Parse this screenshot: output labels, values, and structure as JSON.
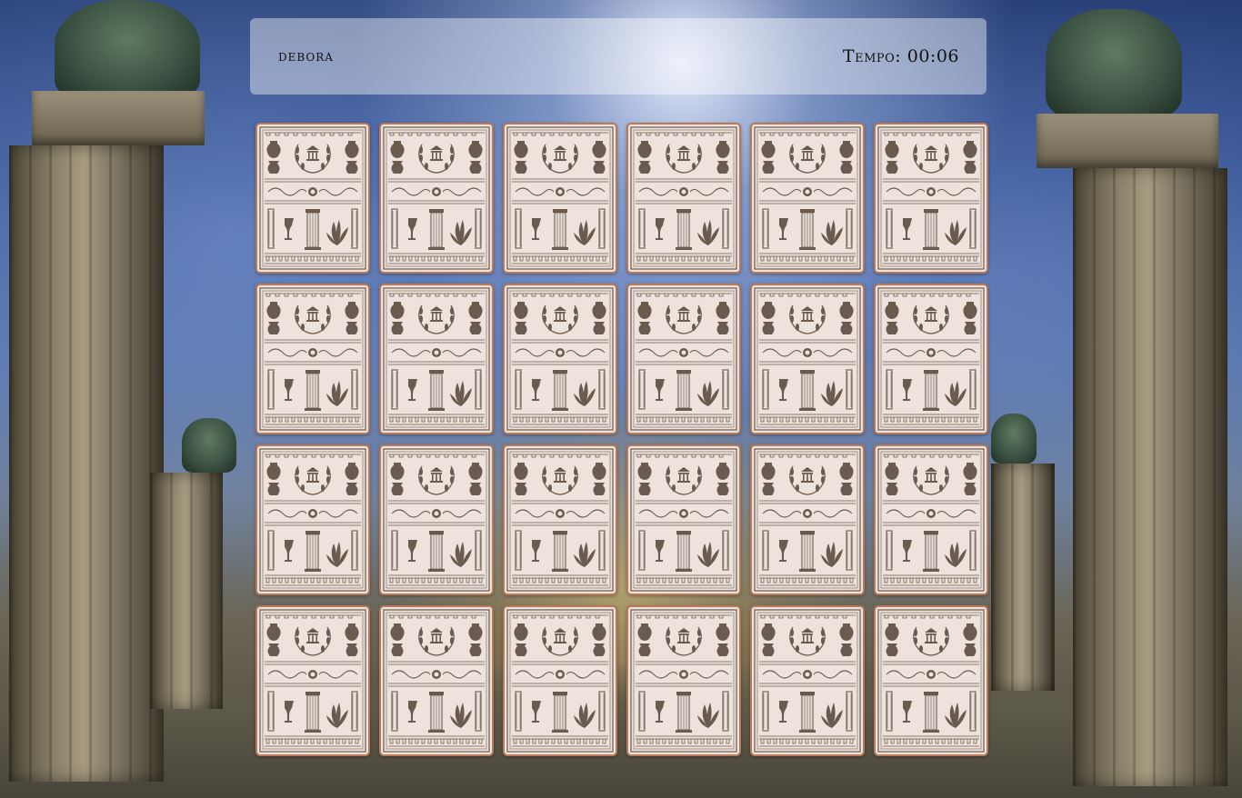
{
  "header": {
    "player_name": "debora",
    "timer_label": "Tempo:",
    "timer_value": "00:06"
  },
  "board": {
    "rows": 4,
    "columns": 6,
    "cards": [
      {
        "state": "face-down"
      },
      {
        "state": "face-down"
      },
      {
        "state": "face-down"
      },
      {
        "state": "face-down"
      },
      {
        "state": "face-down"
      },
      {
        "state": "face-down"
      },
      {
        "state": "face-down"
      },
      {
        "state": "face-down"
      },
      {
        "state": "face-down"
      },
      {
        "state": "face-down"
      },
      {
        "state": "face-down"
      },
      {
        "state": "face-down"
      },
      {
        "state": "face-down"
      },
      {
        "state": "face-down"
      },
      {
        "state": "face-down"
      },
      {
        "state": "face-down"
      },
      {
        "state": "face-down"
      },
      {
        "state": "face-down"
      },
      {
        "state": "face-down"
      },
      {
        "state": "face-down"
      },
      {
        "state": "face-down"
      },
      {
        "state": "face-down"
      },
      {
        "state": "face-down"
      },
      {
        "state": "face-down"
      }
    ],
    "card_back_icon": "greek-pattern-card-back-icon"
  },
  "colors": {
    "card_background": "#ede3dc",
    "card_border": "#b87a58",
    "card_ink": "#6b5a4e",
    "header_background": "rgba(255,255,255,0.42)"
  }
}
